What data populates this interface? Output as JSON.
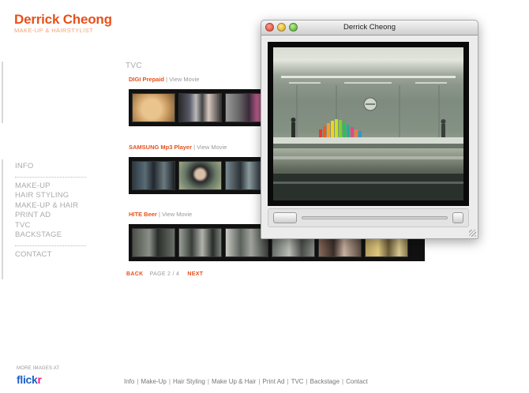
{
  "brand": {
    "name": "Derrick Cheong",
    "tagline": "MAKE-UP & HAIRSTYLIST"
  },
  "nav": {
    "info": "INFO",
    "items": [
      "MAKE-UP",
      "HAIR STYLING",
      "MAKE-UP & HAIR",
      "PRINT AD",
      "TVC",
      "BACKSTAGE"
    ],
    "contact": "CONTACT"
  },
  "section_title": "TVC",
  "tvc_items": [
    {
      "name": "DIGI Prepaid",
      "link": "View Movie"
    },
    {
      "name": "SAMSUNG Mp3 Player",
      "link": "View Movie"
    },
    {
      "name": "HITE Beer",
      "link": "View Movie"
    }
  ],
  "pipe": "|",
  "pager": {
    "back": "BACK",
    "page": "PAGE 2 / 4",
    "next": "NEXT"
  },
  "flickr": {
    "label": "MORE IMAGES AT",
    "logo_part1": "flick",
    "logo_part2": "r"
  },
  "footer_links": [
    "Info",
    "Make-Up",
    "Hair Styling",
    "Make Up & Hair",
    "Print Ad",
    "TVC",
    "Backstage",
    "Contact"
  ],
  "footer_sep": "|",
  "player_window": {
    "title": "Derrick Cheong"
  },
  "colors": {
    "accent": "#e8501a",
    "text_muted": "#999999",
    "flickr_blue": "#1a5fc8",
    "flickr_pink": "#ff1981"
  }
}
